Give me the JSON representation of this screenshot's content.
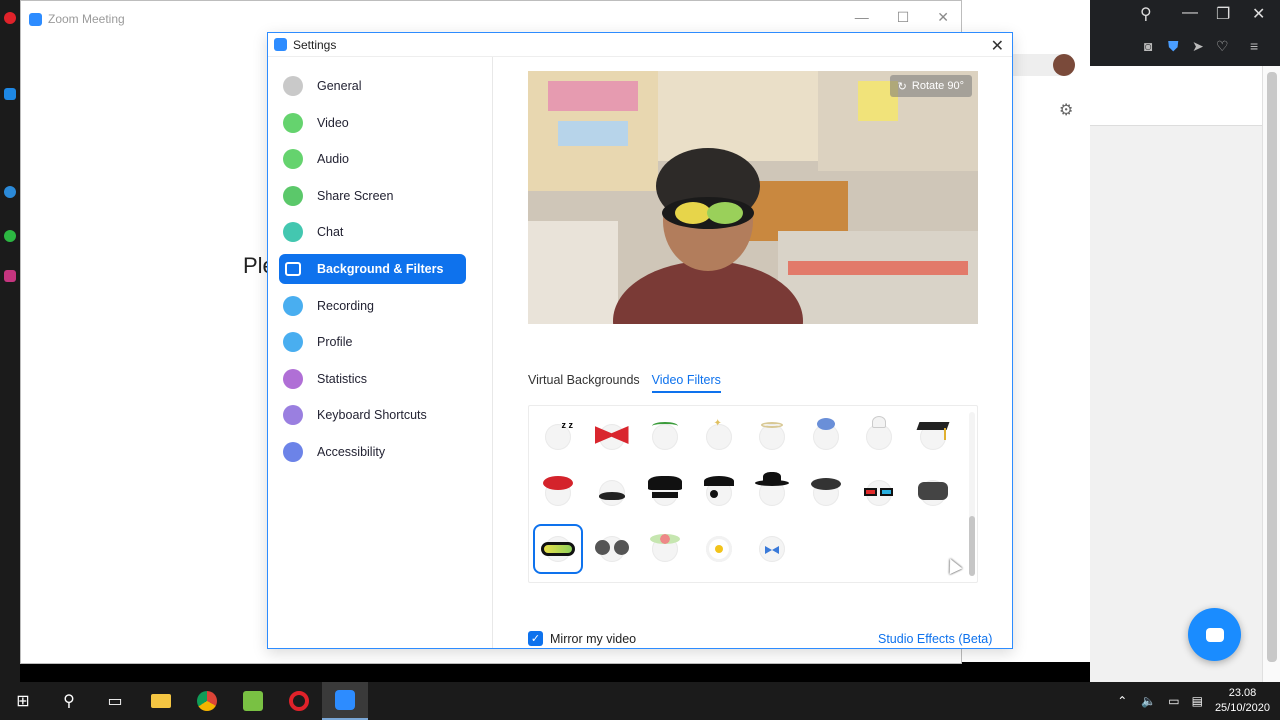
{
  "zoom_window": {
    "title": "Zoom Meeting",
    "partial_text": "Ple"
  },
  "settings": {
    "title": "Settings",
    "close": "✕",
    "nav": [
      {
        "label": "General",
        "icon": "gear-icon",
        "color": "#c9c9c9"
      },
      {
        "label": "Video",
        "icon": "video-camera-icon",
        "color": "#65d36e"
      },
      {
        "label": "Audio",
        "icon": "headphones-icon",
        "color": "#65d36e"
      },
      {
        "label": "Share Screen",
        "icon": "share-screen-icon",
        "color": "#5bc86a"
      },
      {
        "label": "Chat",
        "icon": "chat-icon",
        "color": "#43c7b0"
      },
      {
        "label": "Background & Filters",
        "icon": "background-icon",
        "color": "#0e72ed"
      },
      {
        "label": "Recording",
        "icon": "recording-icon",
        "color": "#49aef0"
      },
      {
        "label": "Profile",
        "icon": "profile-icon",
        "color": "#49aef0"
      },
      {
        "label": "Statistics",
        "icon": "statistics-icon",
        "color": "#b06fd6"
      },
      {
        "label": "Keyboard Shortcuts",
        "icon": "keyboard-icon",
        "color": "#9a7fe0"
      },
      {
        "label": "Accessibility",
        "icon": "accessibility-icon",
        "color": "#6c83e8"
      }
    ],
    "active_nav": "Background & Filters",
    "rotate_label": "Rotate 90°",
    "tabs": [
      "Virtual Backgrounds",
      "Video Filters"
    ],
    "active_tab": "Video Filters",
    "filters": [
      "sleepy-zzz",
      "red-bow",
      "antennae",
      "crown-sparkle",
      "halo",
      "flower-crown",
      "chef-hat",
      "graduation-cap",
      "red-beret",
      "mustache",
      "bandit-mask",
      "pirate-patch",
      "fedora",
      "beret",
      "3d-glasses",
      "vr-headset",
      "ski-goggles",
      "round-sunglasses",
      "flower-wreath",
      "daisy",
      "bowtie"
    ],
    "selected_filter": "ski-goggles",
    "mirror_label": "Mirror my video",
    "mirror_checked": true,
    "studio_effects": "Studio Effects (Beta)"
  },
  "taskbar": {
    "time": "23.08",
    "date": "25/10/2020"
  }
}
